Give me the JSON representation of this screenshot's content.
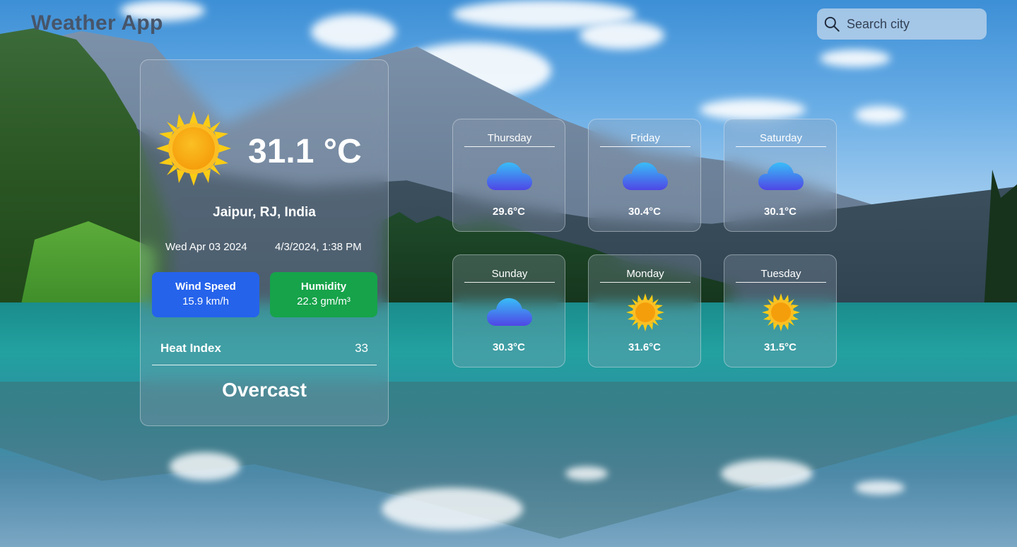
{
  "app": {
    "title": "Weather App"
  },
  "search": {
    "placeholder": "Search city",
    "value": "",
    "icon": "search-icon"
  },
  "current": {
    "icon": "sun-icon",
    "temperature": "31.1 °C",
    "location": "Jaipur, RJ, India",
    "date": "Wed Apr 03 2024",
    "datetime": "4/3/2024, 1:38 PM",
    "wind": {
      "label": "Wind Speed",
      "value": "15.9 km/h",
      "color": "#2563eb"
    },
    "humidity": {
      "label": "Humidity",
      "value": "22.3 gm/m³",
      "color": "#16a34a"
    },
    "heat_index": {
      "label": "Heat Index",
      "value": "33"
    },
    "condition": "Overcast"
  },
  "forecast": [
    {
      "day": "Thursday",
      "temp": "29.6°C",
      "icon": "cloud-icon"
    },
    {
      "day": "Friday",
      "temp": "30.4°C",
      "icon": "cloud-icon"
    },
    {
      "day": "Saturday",
      "temp": "30.1°C",
      "icon": "cloud-icon"
    },
    {
      "day": "Sunday",
      "temp": "30.3°C",
      "icon": "cloud-icon"
    },
    {
      "day": "Monday",
      "temp": "31.6°C",
      "icon": "sun-icon"
    },
    {
      "day": "Tuesday",
      "temp": "31.5°C",
      "icon": "sun-icon"
    }
  ],
  "colors": {
    "title": "#475569",
    "cloud": "#3b82f6",
    "sun": "#fbbf24"
  }
}
